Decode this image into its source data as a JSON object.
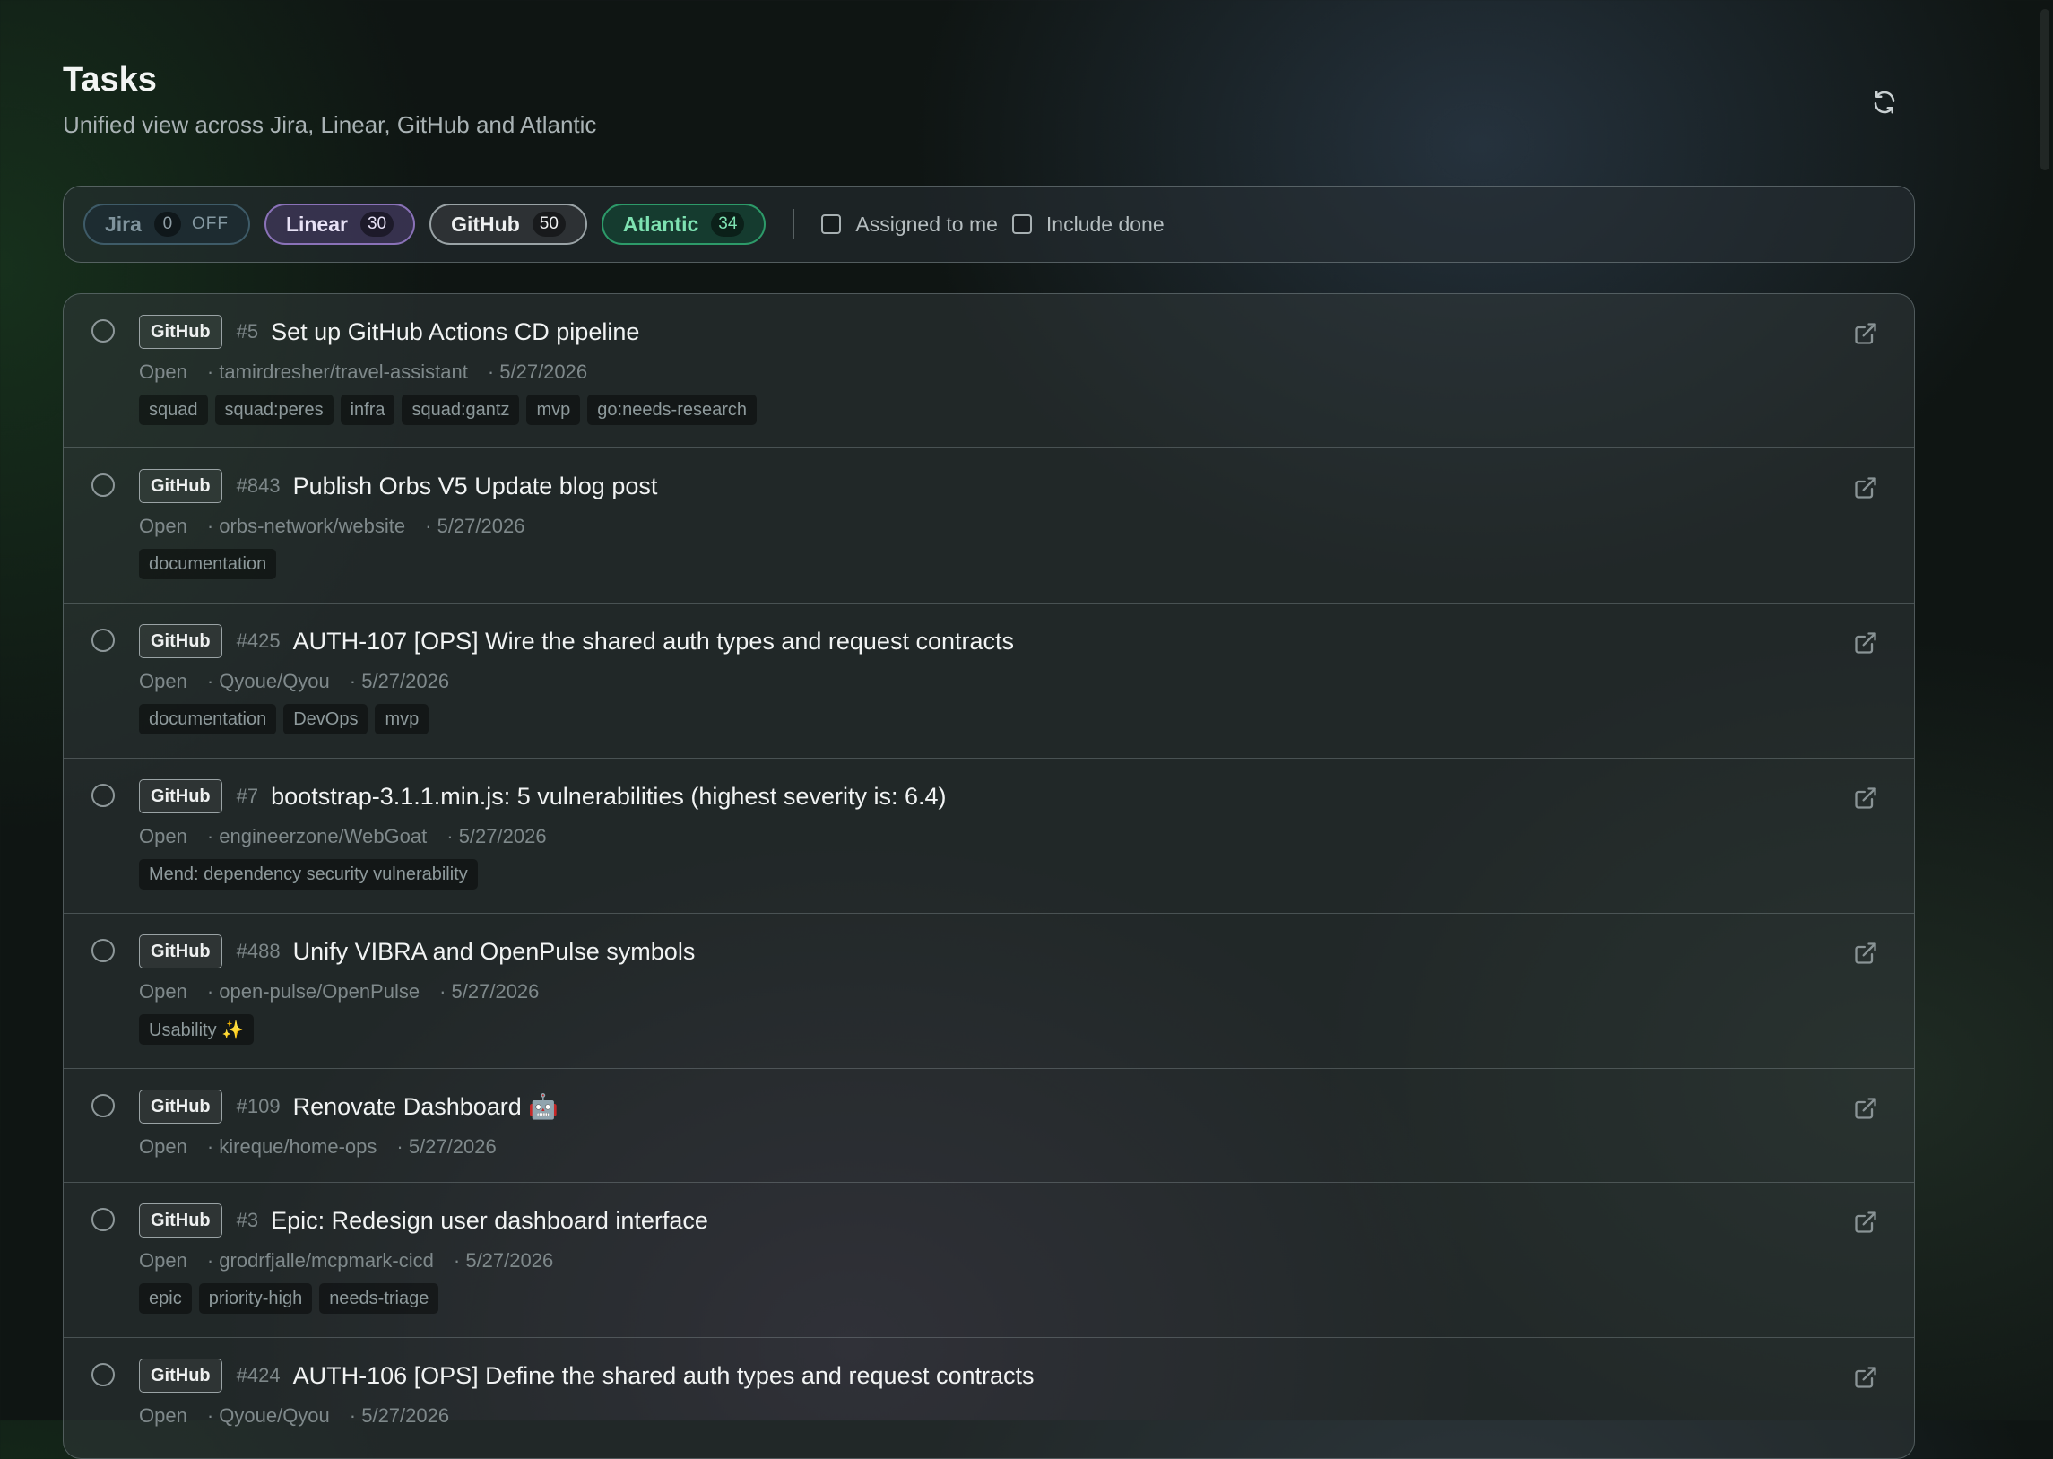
{
  "header": {
    "title": "Tasks",
    "subtitle": "Unified view across Jira, Linear, GitHub and Atlantic"
  },
  "filters": {
    "sources": [
      {
        "name": "Jira",
        "count": "0",
        "state": "OFF"
      },
      {
        "name": "Linear",
        "count": "30"
      },
      {
        "name": "GitHub",
        "count": "50"
      },
      {
        "name": "Atlantic",
        "count": "34"
      }
    ],
    "assigned_to_me": "Assigned to me",
    "include_done": "Include done"
  },
  "colors": {
    "linear": "#8a72b8",
    "atlantic": "#2d9a69",
    "jira": "#3e5b68"
  },
  "icons": {
    "refresh": "refresh-icon",
    "external": "external-link-icon"
  },
  "tasks": [
    {
      "source": "GitHub",
      "number": "#5",
      "title": "Set up GitHub Actions CD pipeline",
      "status": "Open",
      "repo": "· tamirdresher/travel-assistant",
      "date": "· 5/27/2026",
      "tags": [
        "squad",
        "squad:peres",
        "infra",
        "squad:gantz",
        "mvp",
        "go:needs-research"
      ]
    },
    {
      "source": "GitHub",
      "number": "#843",
      "title": "Publish Orbs V5 Update blog post",
      "status": "Open",
      "repo": "· orbs-network/website",
      "date": "· 5/27/2026",
      "tags": [
        "documentation"
      ]
    },
    {
      "source": "GitHub",
      "number": "#425",
      "title": "AUTH-107 [OPS] Wire the shared auth types and request contracts",
      "status": "Open",
      "repo": "· Qyoue/Qyou",
      "date": "· 5/27/2026",
      "tags": [
        "documentation",
        "DevOps",
        "mvp"
      ]
    },
    {
      "source": "GitHub",
      "number": "#7",
      "title": "bootstrap-3.1.1.min.js: 5 vulnerabilities (highest severity is: 6.4)",
      "status": "Open",
      "repo": "· engineerzone/WebGoat",
      "date": "· 5/27/2026",
      "tags": [
        "Mend: dependency security vulnerability"
      ]
    },
    {
      "source": "GitHub",
      "number": "#488",
      "title": "Unify VIBRA and OpenPulse symbols",
      "status": "Open",
      "repo": "· open-pulse/OpenPulse",
      "date": "· 5/27/2026",
      "tags": [
        "Usability ✨"
      ]
    },
    {
      "source": "GitHub",
      "number": "#109",
      "title": "Renovate Dashboard 🤖",
      "status": "Open",
      "repo": "· kireque/home-ops",
      "date": "· 5/27/2026",
      "tags": []
    },
    {
      "source": "GitHub",
      "number": "#3",
      "title": "Epic: Redesign user dashboard interface",
      "status": "Open",
      "repo": "· grodrfjalle/mcpmark-cicd",
      "date": "· 5/27/2026",
      "tags": [
        "epic",
        "priority-high",
        "needs-triage"
      ]
    },
    {
      "source": "GitHub",
      "number": "#424",
      "title": "AUTH-106 [OPS] Define the shared auth types and request contracts",
      "status": "Open",
      "repo": "· Qyoue/Qyou",
      "date": "· 5/27/2026",
      "tags": []
    }
  ]
}
